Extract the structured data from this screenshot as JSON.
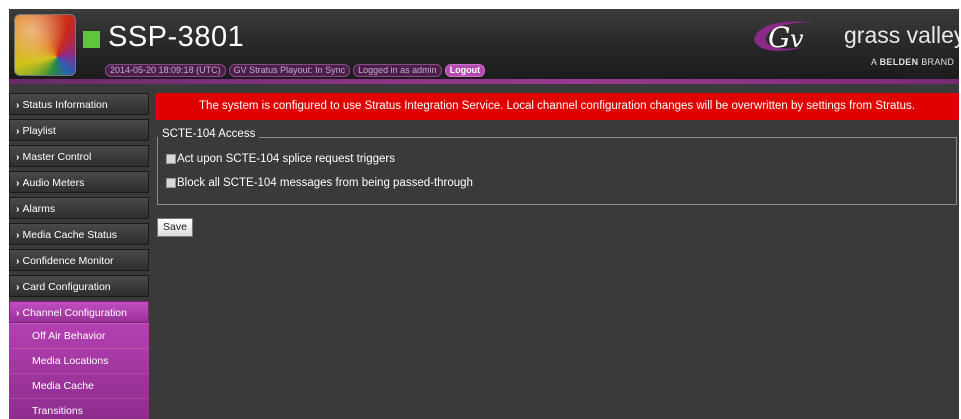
{
  "header": {
    "product_name": "SSP-3801",
    "datetime": "2014-05-20 18:09:18 (UTC)",
    "sync_status": "GV Stratus Playout: In Sync",
    "login_status": "Logged in as admin",
    "logout_label": "Logout",
    "brand_name": "grass valley",
    "brand_sub_prefix": "A ",
    "brand_sub_bold": "BELDEN",
    "brand_sub_suffix": " BRAND"
  },
  "sidebar": {
    "items": [
      {
        "label": "Status Information"
      },
      {
        "label": "Playlist"
      },
      {
        "label": "Master Control"
      },
      {
        "label": "Audio Meters"
      },
      {
        "label": "Alarms"
      },
      {
        "label": "Media Cache Status"
      },
      {
        "label": "Confidence Monitor"
      },
      {
        "label": "Card Configuration"
      },
      {
        "label": "Channel Configuration"
      }
    ],
    "sub_items": [
      {
        "label": "Off Air Behavior"
      },
      {
        "label": "Media Locations"
      },
      {
        "label": "Media Cache"
      },
      {
        "label": "Transitions"
      }
    ]
  },
  "main": {
    "alert": "The system is configured to use Stratus Integration Service. Local channel configuration changes will be overwritten by settings from Stratus.",
    "fieldset_legend": "SCTE-104 Access",
    "option1": "Act upon SCTE-104 splice request triggers",
    "option2": "Block all SCTE-104 messages from being passed-through",
    "save_label": "Save"
  },
  "colors": {
    "accent_purple": "#b440b2",
    "alert_red": "#e00000",
    "status_green": "#5fc63a"
  },
  "icons": [
    "chevron-right-icon",
    "gv-logo-icon",
    "product-logo-icon",
    "status-indicator-icon"
  ]
}
